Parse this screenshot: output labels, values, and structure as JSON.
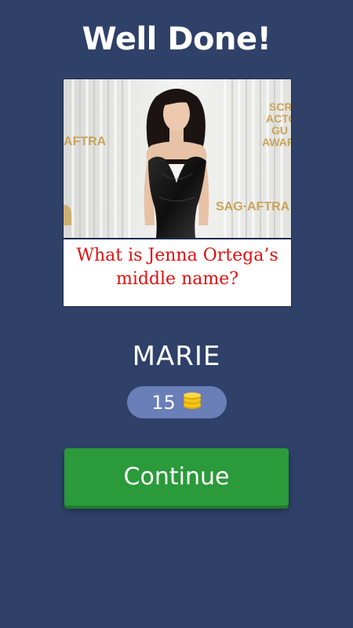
{
  "header": {
    "title": "Well Done!"
  },
  "question_card": {
    "photo_background_texts": {
      "left_logo": "AFTRA",
      "right_logo": "SAG·AFTRA",
      "top_right_lines": [
        "SCR",
        "ACTO",
        "GU",
        "AWAR"
      ]
    },
    "question_text": "What is Jenna Ortega’s middle name?"
  },
  "answer": {
    "text": "MARIE"
  },
  "reward": {
    "coins": "15",
    "icon": "coin-stack-icon"
  },
  "actions": {
    "continue_label": "Continue"
  },
  "colors": {
    "background": "#2f4168",
    "pill": "#6a7eb8",
    "button": "#2a9a3a",
    "question": "#e01010",
    "coin": "#f5c518"
  }
}
